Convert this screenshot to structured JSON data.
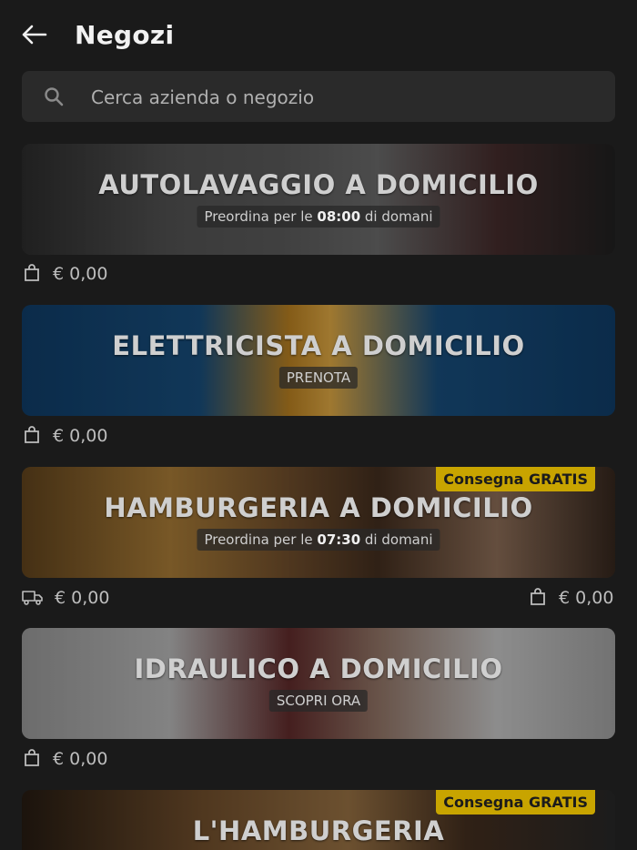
{
  "header": {
    "title": "Negozi"
  },
  "search": {
    "placeholder": "Cerca azienda o negozio"
  },
  "stores": [
    {
      "name": "AUTOLAVAGGIO A DOMICILIO",
      "pill_prefix": "Preordina per le ",
      "pill_time": "08:00",
      "pill_suffix": " di domani",
      "min_order": "€ 0,00"
    },
    {
      "name": "ELETTRICISTA A DOMICILIO",
      "pill_text": "PRENOTA",
      "min_order": "€ 0,00"
    },
    {
      "name": "HAMBURGERIA A DOMICILIO",
      "badge": "Consegna GRATIS",
      "pill_prefix": "Preordina per le ",
      "pill_time": "07:30",
      "pill_suffix": " di domani",
      "delivery_cost": "€ 0,00",
      "min_order": "€ 0,00"
    },
    {
      "name": "IDRAULICO A DOMICILIO",
      "pill_text": "SCOPRI ORA",
      "min_order": "€ 0,00"
    },
    {
      "name": "L'HAMBURGERIA",
      "badge": "Consegna GRATIS"
    }
  ],
  "icons": {
    "back": "arrow-left-icon",
    "search": "search-icon",
    "bag": "shopping-bag-icon",
    "truck": "delivery-truck-icon"
  }
}
